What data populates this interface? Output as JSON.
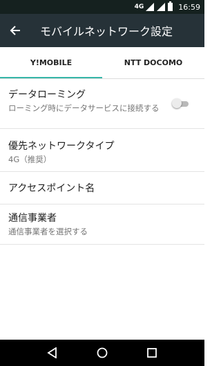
{
  "status_bar": {
    "network_type": "4G",
    "time": "16:59",
    "icons": [
      "signal-icon",
      "signal-icon",
      "battery-icon"
    ]
  },
  "app_bar": {
    "title": "モバイルネットワーク設定",
    "back_icon": "arrow-back-icon"
  },
  "tabs": [
    {
      "label": "Y!MOBILE",
      "active": true
    },
    {
      "label": "NTT DOCOMO",
      "active": false
    }
  ],
  "settings": {
    "data_roaming": {
      "title": "データローミング",
      "summary": "ローミング時にデータサービスに接続する",
      "enabled": false
    },
    "preferred_network": {
      "title": "優先ネットワークタイプ",
      "summary": "4G（推奨）"
    },
    "apn": {
      "title": "アクセスポイント名"
    },
    "operator": {
      "title": "通信事業者",
      "summary": "通信事業者を選択する"
    }
  },
  "nav_bar": {
    "icons": [
      "back-triangle-icon",
      "home-circle-icon",
      "recents-square-icon"
    ]
  },
  "colors": {
    "status_bar": "#15211f",
    "app_bar": "#263238",
    "tab_indicator": "#35b6a8",
    "toggle_track_off": "#b9b9b9",
    "nav_bar": "#000000"
  }
}
